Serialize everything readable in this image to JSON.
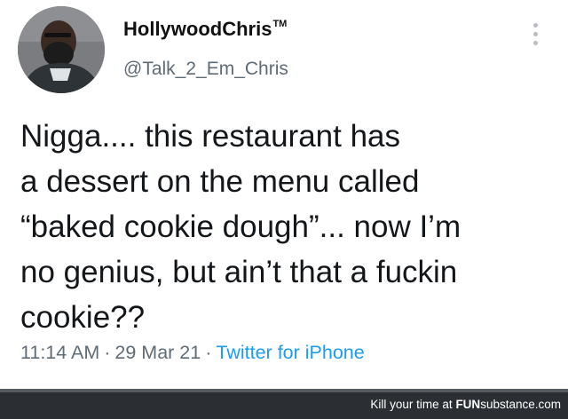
{
  "tweet": {
    "display_name": "HollywoodChris",
    "trademark": "TM",
    "handle": "@Talk_2_Em_Chris",
    "lines": [
      "Nigga.... this restaurant has",
      "a dessert on the menu called",
      "“baked cookie dough”... now I’m",
      "no genius, but ain’t that a fuckin",
      "cookie??"
    ],
    "time": "11:14 AM",
    "separator": "·",
    "date": "29 Mar 21",
    "source": "Twitter for iPhone",
    "avatar_icon": "profile-photo",
    "more_icon": "vertical-ellipsis-icon"
  },
  "footer": {
    "caption": "Kill your time at",
    "brand_fun": "FUN",
    "brand_substance": "substance",
    "brand_tld": ".com"
  },
  "colors": {
    "link": "#1d9bf0",
    "secondary_text": "#5f6b75",
    "footer_bg": "#2b2f33"
  }
}
